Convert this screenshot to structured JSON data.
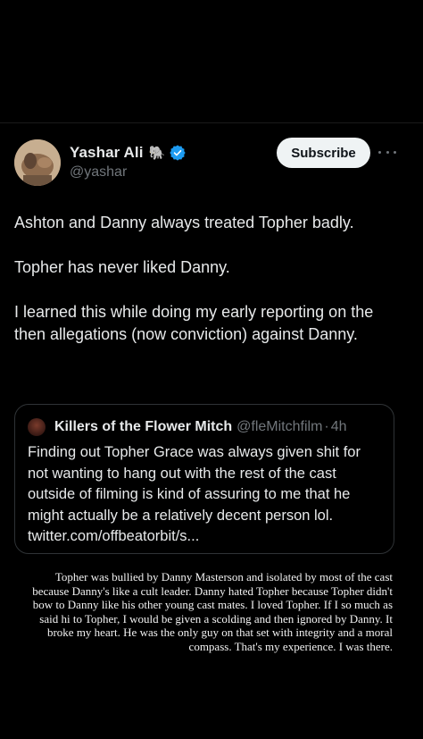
{
  "tweet": {
    "author": {
      "display_name": "Yashar Ali",
      "emoji": "🐘",
      "handle": "@yashar",
      "verified": true
    },
    "subscribe_label": "Subscribe",
    "paragraphs": [
      "Ashton and Danny always treated Topher badly.",
      "Topher has never liked Danny.",
      "I learned this while doing my early reporting on the then allegations (now conviction) against Danny."
    ],
    "quote": {
      "display_name": "Killers of the Flower Mitch",
      "handle": "@fleMitchfilm",
      "separator": "·",
      "time": "4h",
      "text": "Finding out Topher Grace was always given shit for not wanting to hang out with the rest of the cast outside of filming is kind of assuring to me that he might actually be a relatively decent person lol. twitter.com/offbeatorbit/s..."
    }
  },
  "caption": {
    "text": "Topher was bullied by Danny Masterson and isolated by most of the cast because Danny's like a cult leader. Danny hated Topher because Topher didn't bow to Danny like his other young cast mates. I loved Topher. If I so much as said hi to Topher, I would be given a scolding and then ignored by Danny. It broke my heart. He was the only guy on that set with integrity and a moral compass. That's my experience. I was there."
  },
  "colors": {
    "background": "#000000",
    "text_primary": "#e7e9ea",
    "text_secondary": "#71767b",
    "verified_blue": "#1d9bf0",
    "button_bg": "#eff3f4",
    "border": "#2f3336"
  }
}
